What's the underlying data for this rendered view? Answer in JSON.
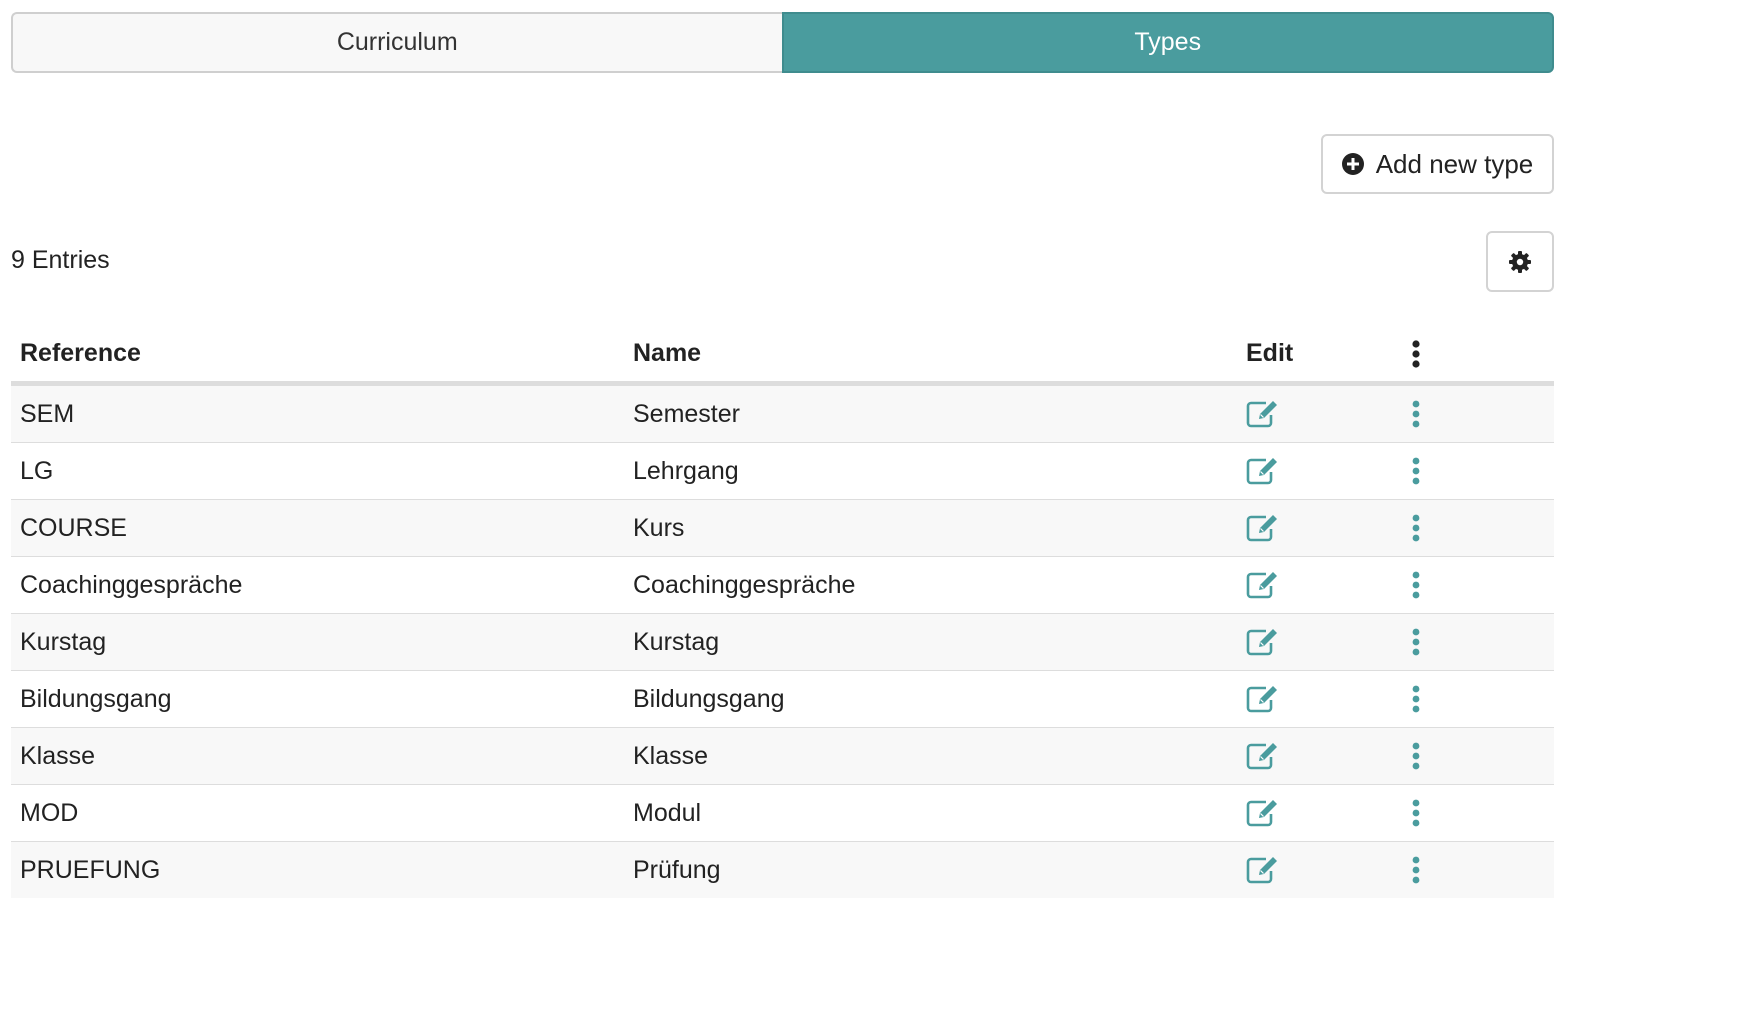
{
  "tabs": [
    {
      "label": "Curriculum",
      "active": false
    },
    {
      "label": "Types",
      "active": true
    }
  ],
  "toolbar": {
    "add_label": "Add new type",
    "add_icon": "plus-circle-icon",
    "settings_icon": "gear-icon"
  },
  "entries_count": "9 Entries",
  "table": {
    "headers": {
      "reference": "Reference",
      "name": "Name",
      "edit": "Edit",
      "more_icon": "vertical-ellipsis-icon"
    },
    "rows": [
      {
        "reference": "SEM",
        "name": "Semester"
      },
      {
        "reference": "LG",
        "name": "Lehrgang"
      },
      {
        "reference": "COURSE",
        "name": "Kurs"
      },
      {
        "reference": "Coachinggespräche",
        "name": "Coachinggespräche"
      },
      {
        "reference": "Kurstag",
        "name": "Kurstag"
      },
      {
        "reference": "Bildungsgang",
        "name": "Bildungsgang"
      },
      {
        "reference": "Klasse",
        "name": "Klasse"
      },
      {
        "reference": "MOD",
        "name": "Modul"
      },
      {
        "reference": "PRUEFUNG",
        "name": "Prüfung"
      }
    ],
    "row_icons": {
      "edit": "edit-icon",
      "more": "vertical-ellipsis-icon"
    }
  },
  "colors": {
    "accent": "#4a9c9e",
    "border": "#d3d3d3",
    "stripe": "#f8f8f8"
  }
}
